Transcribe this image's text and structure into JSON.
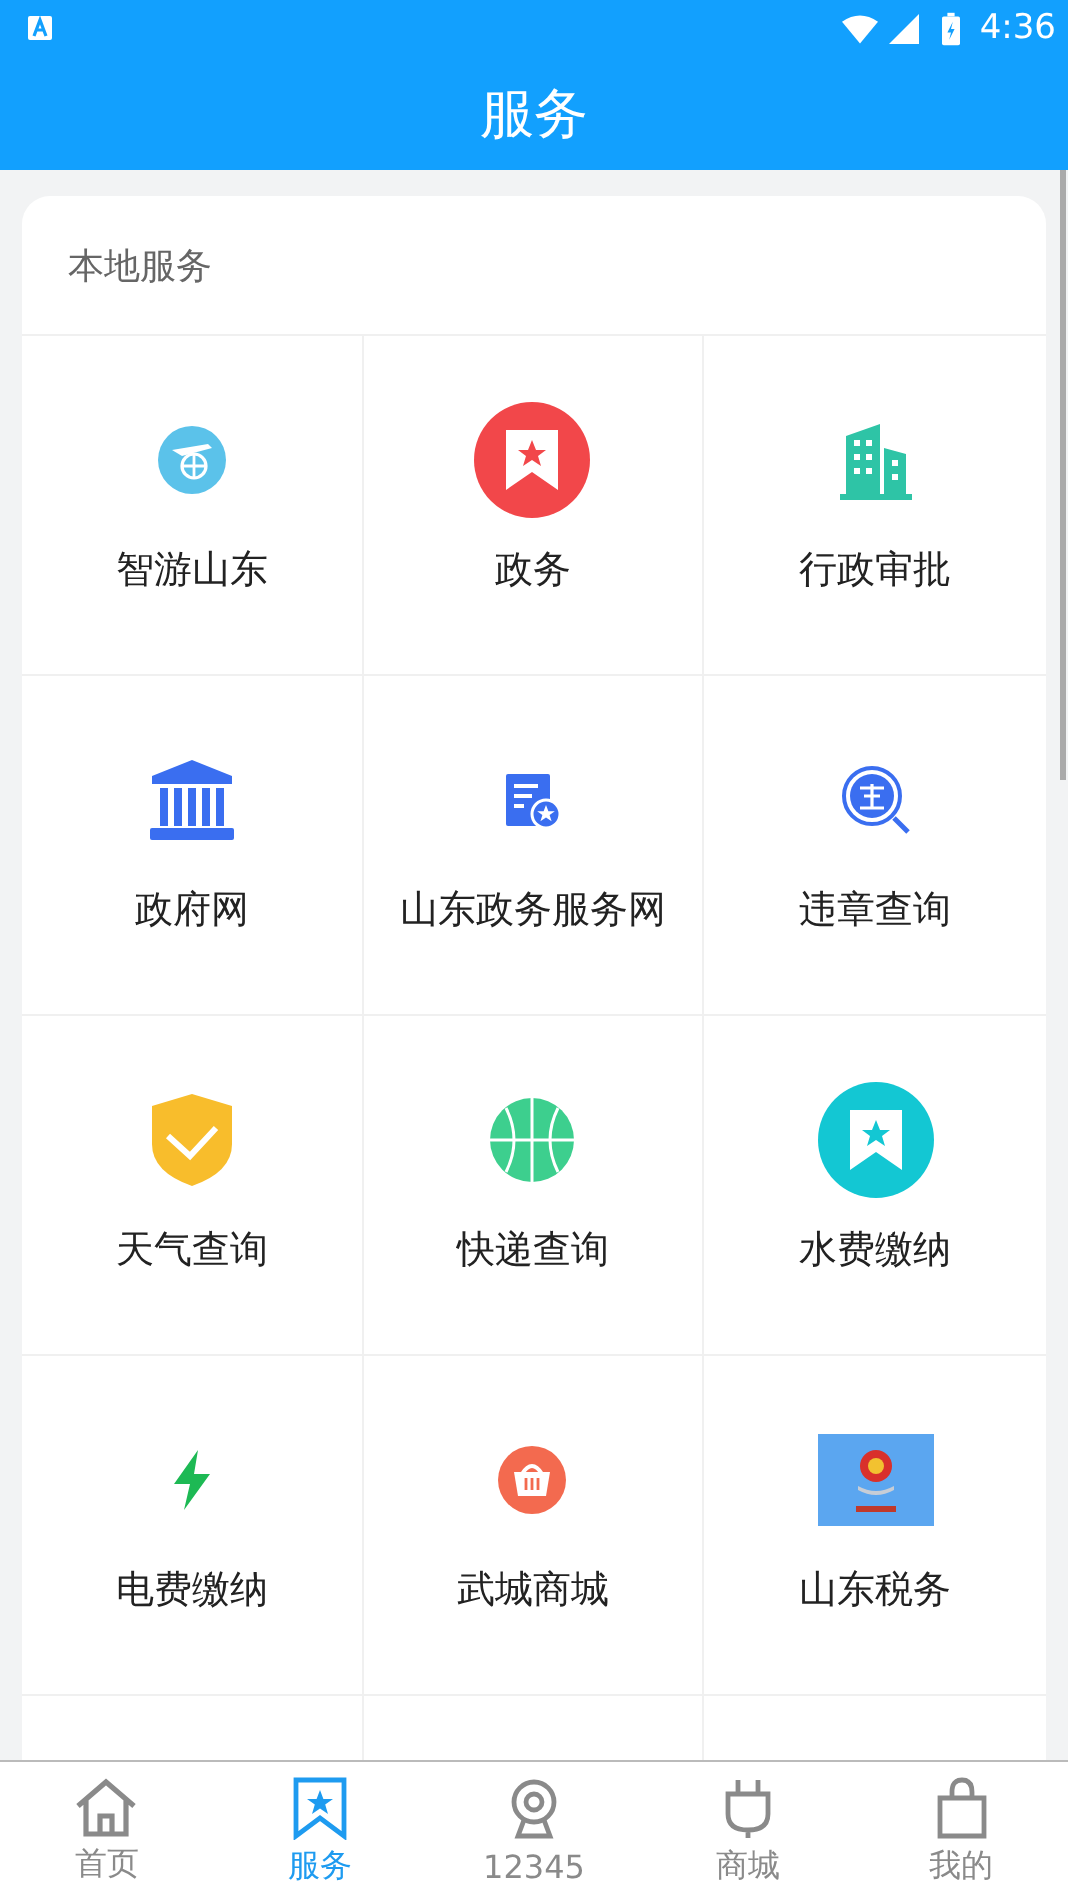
{
  "status_bar": {
    "time": "4:36"
  },
  "app_bar": {
    "title": "服务"
  },
  "section": {
    "title": "本地服务",
    "items": [
      {
        "label": "智游山东",
        "kind": "plane"
      },
      {
        "label": "政务",
        "kind": "red-bookmark"
      },
      {
        "label": "行政审批",
        "kind": "building"
      },
      {
        "label": "政府网",
        "kind": "columns"
      },
      {
        "label": "山东政务服务网",
        "kind": "document"
      },
      {
        "label": "违章查询",
        "kind": "magnifier"
      },
      {
        "label": "天气查询",
        "kind": "shield"
      },
      {
        "label": "快递查询",
        "kind": "ball"
      },
      {
        "label": "水费缴纳",
        "kind": "teal-bookmark"
      },
      {
        "label": "电费缴纳",
        "kind": "bolt"
      },
      {
        "label": "武城商城",
        "kind": "basket"
      },
      {
        "label": "山东税务",
        "kind": "emblem"
      }
    ]
  },
  "bottom_nav": [
    {
      "label": "首页",
      "kind": "home",
      "selected": false
    },
    {
      "label": "服务",
      "kind": "bookmark",
      "selected": true
    },
    {
      "label": "12345",
      "kind": "webcam",
      "selected": false
    },
    {
      "label": "商城",
      "kind": "plug",
      "selected": false
    },
    {
      "label": "我的",
      "kind": "bag",
      "selected": false
    }
  ]
}
